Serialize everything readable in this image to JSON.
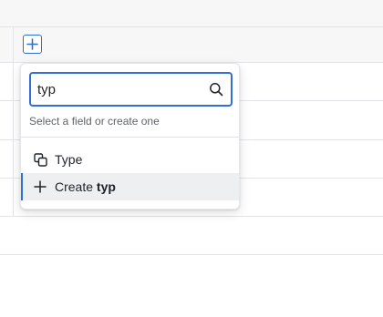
{
  "toolbar": {
    "add_field_icon": "plus-icon"
  },
  "field_picker": {
    "search": {
      "value": "typ",
      "placeholder": "",
      "icon": "search-icon"
    },
    "hint": "Select a field or create one",
    "items": [
      {
        "icon": "copy-icon",
        "label": "Type"
      },
      {
        "icon": "plus-icon",
        "label_prefix": "Create ",
        "label_query": "typ",
        "highlighted": true
      }
    ]
  },
  "colors": {
    "accent": "#2f6fd6",
    "highlight_bg": "#eeeff1",
    "grid_line": "#e3e4e7",
    "header_bg": "#f7f7f8"
  }
}
